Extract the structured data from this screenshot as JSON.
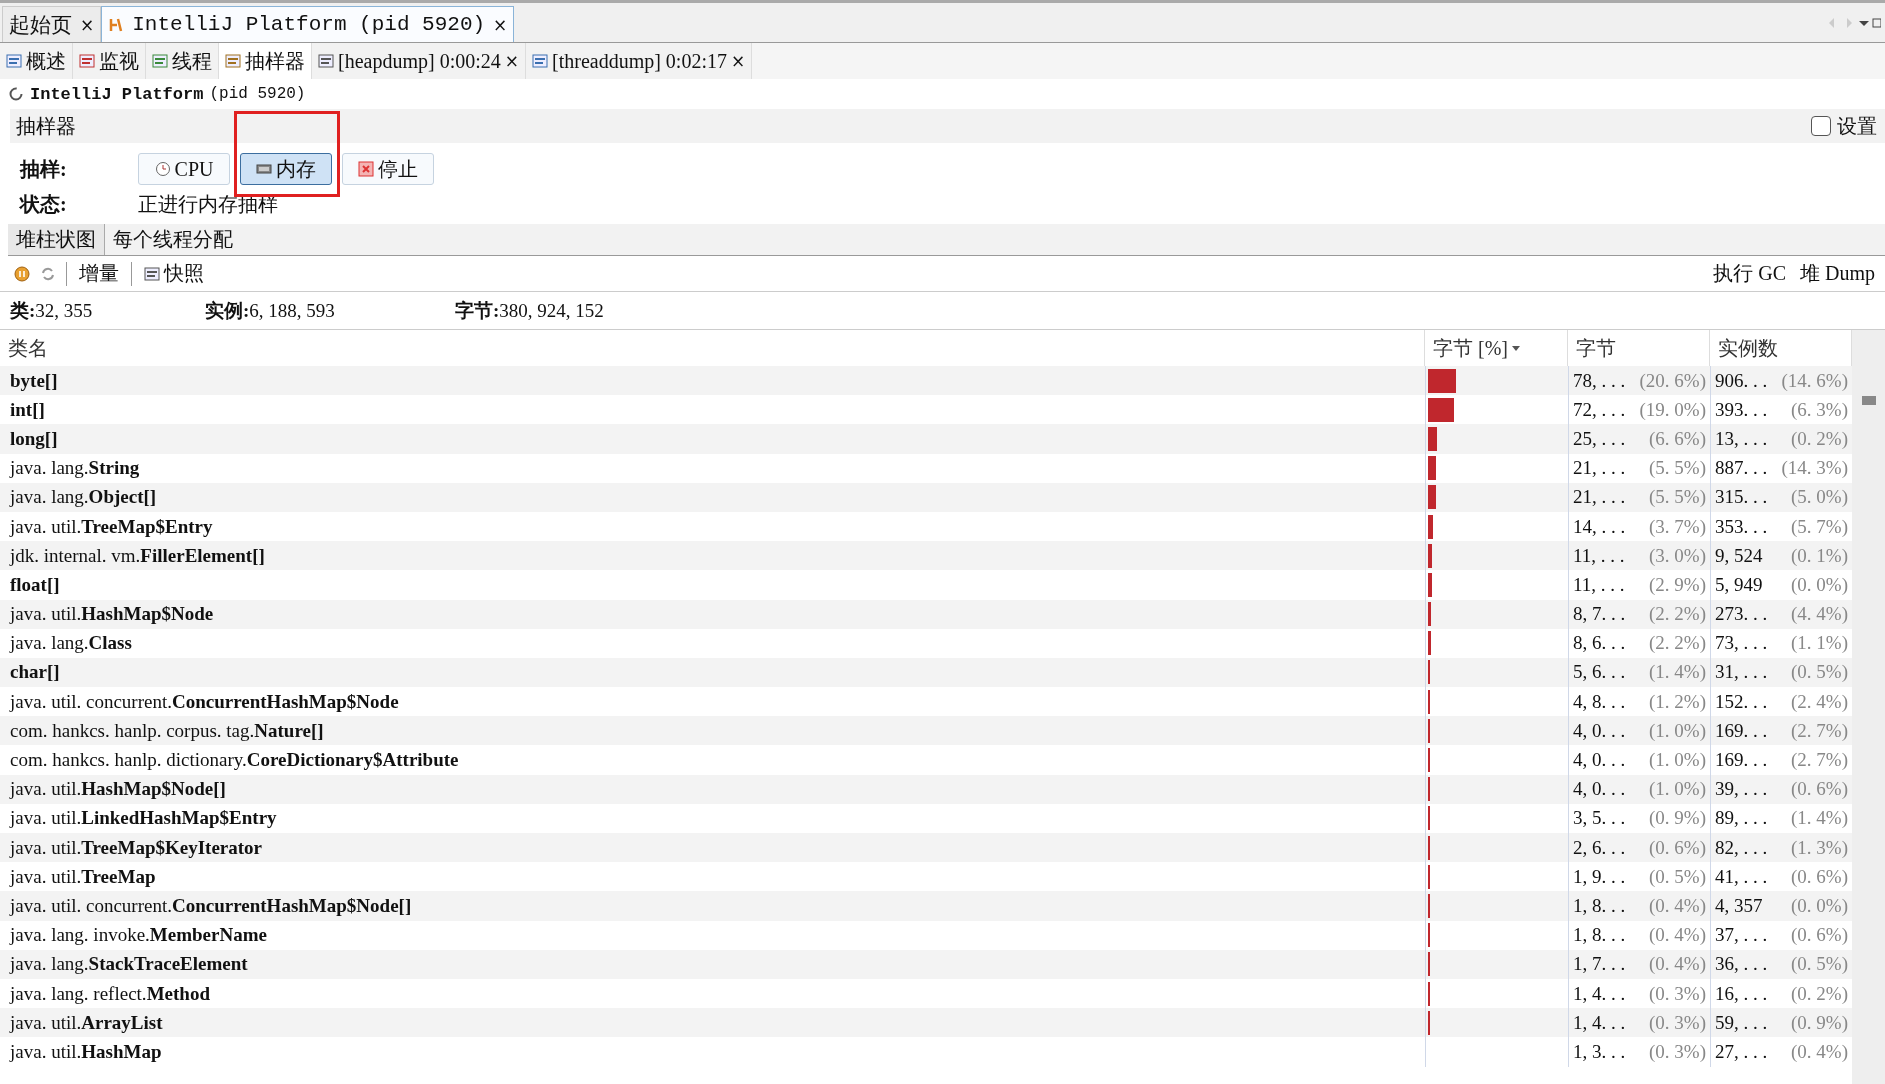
{
  "editor_tabs": [
    {
      "label": "起始页",
      "selected": false,
      "close": "×"
    },
    {
      "label": "IntelliJ Platform (pid 5920)",
      "selected": true,
      "close": "×"
    }
  ],
  "view_tabs": [
    {
      "label": "概述",
      "selected": false
    },
    {
      "label": "监视",
      "selected": false
    },
    {
      "label": "线程",
      "selected": false
    },
    {
      "label": "抽样器",
      "selected": true
    },
    {
      "label": "[heapdump] 0:00:24",
      "selected": false,
      "close": "×"
    },
    {
      "label": "[threaddump] 0:02:17",
      "selected": false,
      "close": "×"
    }
  ],
  "process": {
    "name": "IntelliJ Platform",
    "pid": "(pid 5920)"
  },
  "section": {
    "title": "抽样器",
    "settings_label": "设置",
    "settings_checked": false
  },
  "sampling": {
    "label": "抽样:",
    "buttons": [
      {
        "label": "CPU",
        "kind": "cpu",
        "selected": false,
        "highlighted": false
      },
      {
        "label": "内存",
        "kind": "memory",
        "selected": true,
        "highlighted": true
      },
      {
        "label": "停止",
        "kind": "stop",
        "selected": false,
        "highlighted": false
      }
    ],
    "status_label": "状态:",
    "status": "正进行内存抽样"
  },
  "result_tabs": [
    {
      "label": "堆柱状图",
      "selected": true
    },
    {
      "label": "每个线程分配",
      "selected": false
    }
  ],
  "toolbar": {
    "delta": "增量",
    "snapshot": "快照",
    "gc": "执行 GC",
    "heap_dump": "堆 Dump"
  },
  "stats": [
    {
      "label": "类:",
      "value": "32, 355"
    },
    {
      "label": "实例:",
      "value": "6, 188, 593"
    },
    {
      "label": "字节:",
      "value": "380, 924, 152"
    }
  ],
  "table": {
    "columns": [
      "类名",
      "字节 [%]",
      "字节",
      "实例数"
    ],
    "rows": [
      {
        "package": "",
        "name": "byte[]",
        "level": 0.206,
        "bytes": "78, . . .",
        "bytes_pct": "(20. 6%)",
        "instances": "906. . .",
        "instances_pct": "(14. 6%)"
      },
      {
        "package": "",
        "name": "int[]",
        "level": 0.19,
        "bytes": "72, . . .",
        "bytes_pct": "(19. 0%)",
        "instances": "393. . .",
        "instances_pct": "(6. 3%)"
      },
      {
        "package": "",
        "name": "long[]",
        "level": 0.066,
        "bytes": "25, . . .",
        "bytes_pct": "(6. 6%)",
        "instances": "13, . . .",
        "instances_pct": "(0. 2%)"
      },
      {
        "package": "java. lang. ",
        "name": "String",
        "level": 0.055,
        "bytes": "21, . . .",
        "bytes_pct": "(5. 5%)",
        "instances": "887. . .",
        "instances_pct": "(14. 3%)"
      },
      {
        "package": "java. lang. ",
        "name": "Object[]",
        "level": 0.055,
        "bytes": "21, . . .",
        "bytes_pct": "(5. 5%)",
        "instances": "315. . .",
        "instances_pct": "(5. 0%)"
      },
      {
        "package": "java. util. ",
        "name": "TreeMap$Entry",
        "level": 0.037,
        "bytes": "14, . . .",
        "bytes_pct": "(3. 7%)",
        "instances": "353. . .",
        "instances_pct": "(5. 7%)"
      },
      {
        "package": "jdk. internal. vm. ",
        "name": "FillerElement[]",
        "level": 0.03,
        "bytes": "11, . . .",
        "bytes_pct": "(3. 0%)",
        "instances": "9, 524",
        "instances_pct": "(0. 1%)"
      },
      {
        "package": "",
        "name": "float[]",
        "level": 0.029,
        "bytes": "11, . . .",
        "bytes_pct": "(2. 9%)",
        "instances": "5, 949",
        "instances_pct": "(0. 0%)"
      },
      {
        "package": "java. util. ",
        "name": "HashMap$Node",
        "level": 0.022,
        "bytes": "8, 7. . .",
        "bytes_pct": "(2. 2%)",
        "instances": "273. . .",
        "instances_pct": "(4. 4%)"
      },
      {
        "package": "java. lang. ",
        "name": "Class",
        "level": 0.022,
        "bytes": "8, 6. . .",
        "bytes_pct": "(2. 2%)",
        "instances": "73, . . .",
        "instances_pct": "(1. 1%)"
      },
      {
        "package": "",
        "name": "char[]",
        "level": 0.014,
        "bytes": "5, 6. . .",
        "bytes_pct": "(1. 4%)",
        "instances": "31, . . .",
        "instances_pct": "(0. 5%)"
      },
      {
        "package": "java. util. concurrent. ",
        "name": "ConcurrentHashMap$Node",
        "level": 0.012,
        "bytes": "4, 8. . .",
        "bytes_pct": "(1. 2%)",
        "instances": "152. . .",
        "instances_pct": "(2. 4%)"
      },
      {
        "package": "com. hankcs. hanlp. corpus. tag. ",
        "name": "Nature[]",
        "level": 0.01,
        "bytes": "4, 0. . .",
        "bytes_pct": "(1. 0%)",
        "instances": "169. . .",
        "instances_pct": "(2. 7%)"
      },
      {
        "package": "com. hankcs. hanlp. dictionary. ",
        "name": "CoreDictionary$Attribute",
        "level": 0.01,
        "bytes": "4, 0. . .",
        "bytes_pct": "(1. 0%)",
        "instances": "169. . .",
        "instances_pct": "(2. 7%)"
      },
      {
        "package": "java. util. ",
        "name": "HashMap$Node[]",
        "level": 0.01,
        "bytes": "4, 0. . .",
        "bytes_pct": "(1. 0%)",
        "instances": "39, . . .",
        "instances_pct": "(0. 6%)"
      },
      {
        "package": "java. util. ",
        "name": "LinkedHashMap$Entry",
        "level": 0.009,
        "bytes": "3, 5. . .",
        "bytes_pct": "(0. 9%)",
        "instances": "89, . . .",
        "instances_pct": "(1. 4%)"
      },
      {
        "package": "java. util. ",
        "name": "TreeMap$KeyIterator",
        "level": 0.006,
        "bytes": "2, 6. . .",
        "bytes_pct": "(0. 6%)",
        "instances": "82, . . .",
        "instances_pct": "(1. 3%)"
      },
      {
        "package": "java. util. ",
        "name": "TreeMap",
        "level": 0.005,
        "bytes": "1, 9. . .",
        "bytes_pct": "(0. 5%)",
        "instances": "41, . . .",
        "instances_pct": "(0. 6%)"
      },
      {
        "package": "java. util. concurrent. ",
        "name": "ConcurrentHashMap$Node[]",
        "level": 0.004,
        "bytes": "1, 8. . .",
        "bytes_pct": "(0. 4%)",
        "instances": "4, 357",
        "instances_pct": "(0. 0%)"
      },
      {
        "package": "java. lang. invoke. ",
        "name": "MemberName",
        "level": 0.004,
        "bytes": "1, 8. . .",
        "bytes_pct": "(0. 4%)",
        "instances": "37, . . .",
        "instances_pct": "(0. 6%)"
      },
      {
        "package": "java. lang. ",
        "name": "StackTraceElement",
        "level": 0.004,
        "bytes": "1, 7. . .",
        "bytes_pct": "(0. 4%)",
        "instances": "36, . . .",
        "instances_pct": "(0. 5%)"
      },
      {
        "package": "java. lang. reflect. ",
        "name": "Method",
        "level": 0.003,
        "bytes": "1, 4. . .",
        "bytes_pct": "(0. 3%)",
        "instances": "16, . . .",
        "instances_pct": "(0. 2%)"
      },
      {
        "package": "java. util. ",
        "name": "ArrayList",
        "level": 0.003,
        "bytes": "1, 4. . .",
        "bytes_pct": "(0. 3%)",
        "instances": "59, . . .",
        "instances_pct": "(0. 9%)"
      },
      {
        "package": "java. util. ",
        "name": "HashMap",
        "bytes": "1, 3. . .",
        "bytes_pct": "(0. 3%)",
        "instances": "27, . . .",
        "instances_pct": "(0. 4%)"
      }
    ]
  }
}
